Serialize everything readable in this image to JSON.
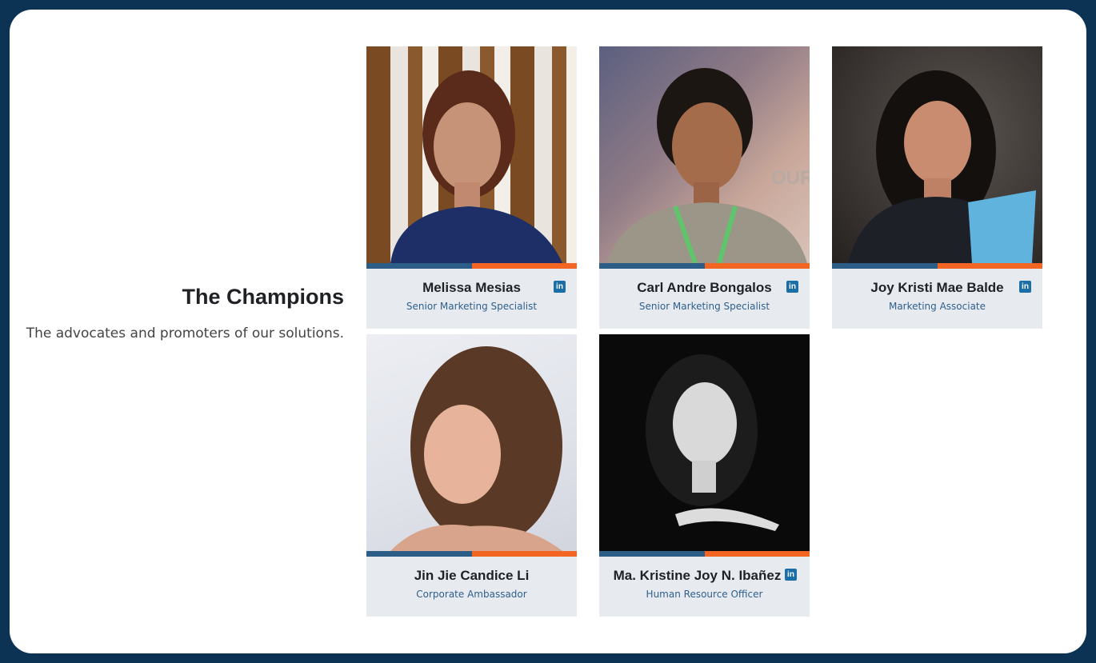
{
  "section": {
    "title": "The Champions",
    "subtitle": "The advocates and promoters of our solutions."
  },
  "colors": {
    "background": "#0c3354",
    "card": "#e7ebef",
    "stripe_blue": "#2b5d86",
    "stripe_orange": "#f26522",
    "linkedin": "#1b6fa6"
  },
  "members": [
    {
      "name": "Melissa Mesias",
      "role": "Senior Marketing Specialist",
      "linkedin": true,
      "linkedin_icon": "linkedin-icon"
    },
    {
      "name": "Carl Andre Bongalos",
      "role": "Senior Marketing Specialist",
      "linkedin": true,
      "linkedin_icon": "linkedin-icon"
    },
    {
      "name": "Joy Kristi Mae Balde",
      "role": "Marketing Associate",
      "linkedin": true,
      "linkedin_icon": "linkedin-icon"
    },
    {
      "name": "Jin Jie Candice Li",
      "role": "Corporate Ambassador",
      "linkedin": false
    },
    {
      "name": "Ma. Kristine Joy N. Ibañez",
      "role": "Human Resource Officer",
      "linkedin": true,
      "linkedin_icon": "linkedin-icon"
    }
  ]
}
